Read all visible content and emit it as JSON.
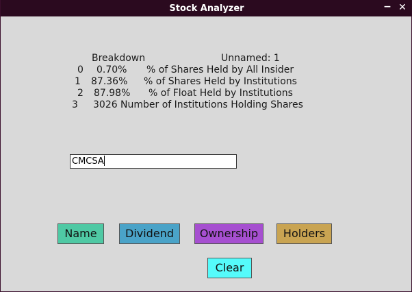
{
  "window": {
    "title": "Stock Analyzer",
    "minimize_glyph": "−",
    "close_glyph": "✕"
  },
  "table": {
    "headers": {
      "breakdown": "Breakdown",
      "unnamed": "Unnamed: 1"
    },
    "rows": [
      {
        "index": "0",
        "value": "0.70%",
        "label": "% of Shares Held by All Insider"
      },
      {
        "index": "1",
        "value": "87.36%",
        "label": "% of Shares Held by Institutions"
      },
      {
        "index": "2",
        "value": "87.98%",
        "label": "% of Float Held by Institutions"
      },
      {
        "index": "3",
        "value": "3026",
        "label": "Number of Institutions Holding Shares"
      }
    ]
  },
  "ticker_input": {
    "value": "CMCSA"
  },
  "buttons": {
    "name": "Name",
    "dividend": "Dividend",
    "ownership": "Ownership",
    "holders": "Holders",
    "clear": "Clear"
  },
  "colors": {
    "titlebar": "#2b0a1f",
    "background": "#d9d9d9",
    "name_button": "#4fc9a4",
    "dividend_button": "#4aa3c8",
    "ownership_button": "#a64fd0",
    "holders_button": "#c9a452",
    "clear_button": "#55fbfb"
  }
}
